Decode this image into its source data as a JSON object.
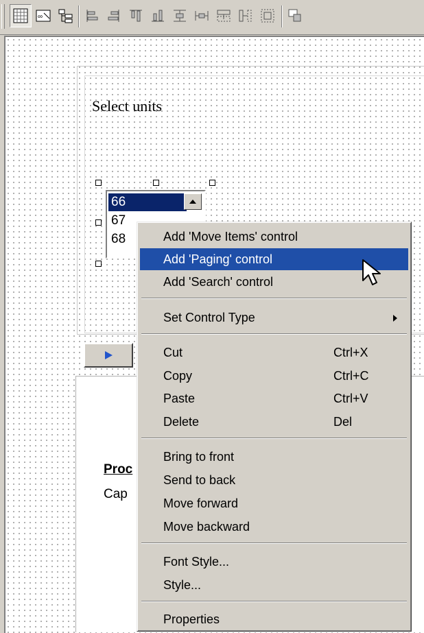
{
  "toolbar": {
    "buttons": [
      {
        "icon": "grid-icon",
        "pressed": true
      },
      {
        "icon": "tab-order-icon"
      },
      {
        "icon": "tree-properties-icon"
      },
      {
        "icon": "align-left-icon"
      },
      {
        "icon": "align-right-icon"
      },
      {
        "icon": "align-top-icon"
      },
      {
        "icon": "align-bottom-icon"
      },
      {
        "icon": "center-vertically-icon"
      },
      {
        "icon": "make-same-width-icon"
      },
      {
        "icon": "make-same-height-icon"
      },
      {
        "icon": "space-evenly-icon"
      },
      {
        "icon": "make-same-size-icon"
      },
      {
        "icon": "bring-to-front-icon"
      }
    ]
  },
  "form": {
    "select_label": "Select units",
    "list_items": [
      "66",
      "67",
      "68"
    ],
    "selected_index": 0,
    "product_label": "Proc",
    "caption_label": "Cap"
  },
  "context_menu": {
    "sections": [
      [
        {
          "label": "Add 'Move Items' control"
        },
        {
          "label": "Add 'Paging' control",
          "highlighted": true
        },
        {
          "label": "Add 'Search' control"
        }
      ],
      [
        {
          "label": "Set Control Type",
          "submenu": true
        }
      ],
      [
        {
          "label": "Cut",
          "shortcut": "Ctrl+X"
        },
        {
          "label": "Copy",
          "shortcut": "Ctrl+C"
        },
        {
          "label": "Paste",
          "shortcut": "Ctrl+V"
        },
        {
          "label": "Delete",
          "shortcut": "Del"
        }
      ],
      [
        {
          "label": "Bring to front"
        },
        {
          "label": "Send to back"
        },
        {
          "label": "Move forward"
        },
        {
          "label": "Move backward"
        }
      ],
      [
        {
          "label": "Font Style..."
        },
        {
          "label": "Style..."
        }
      ],
      [
        {
          "label": "Properties"
        }
      ]
    ]
  },
  "colors": {
    "highlight": "#1f4fa8",
    "list_selection": "#0a246a",
    "chrome": "#d4d0c8"
  }
}
